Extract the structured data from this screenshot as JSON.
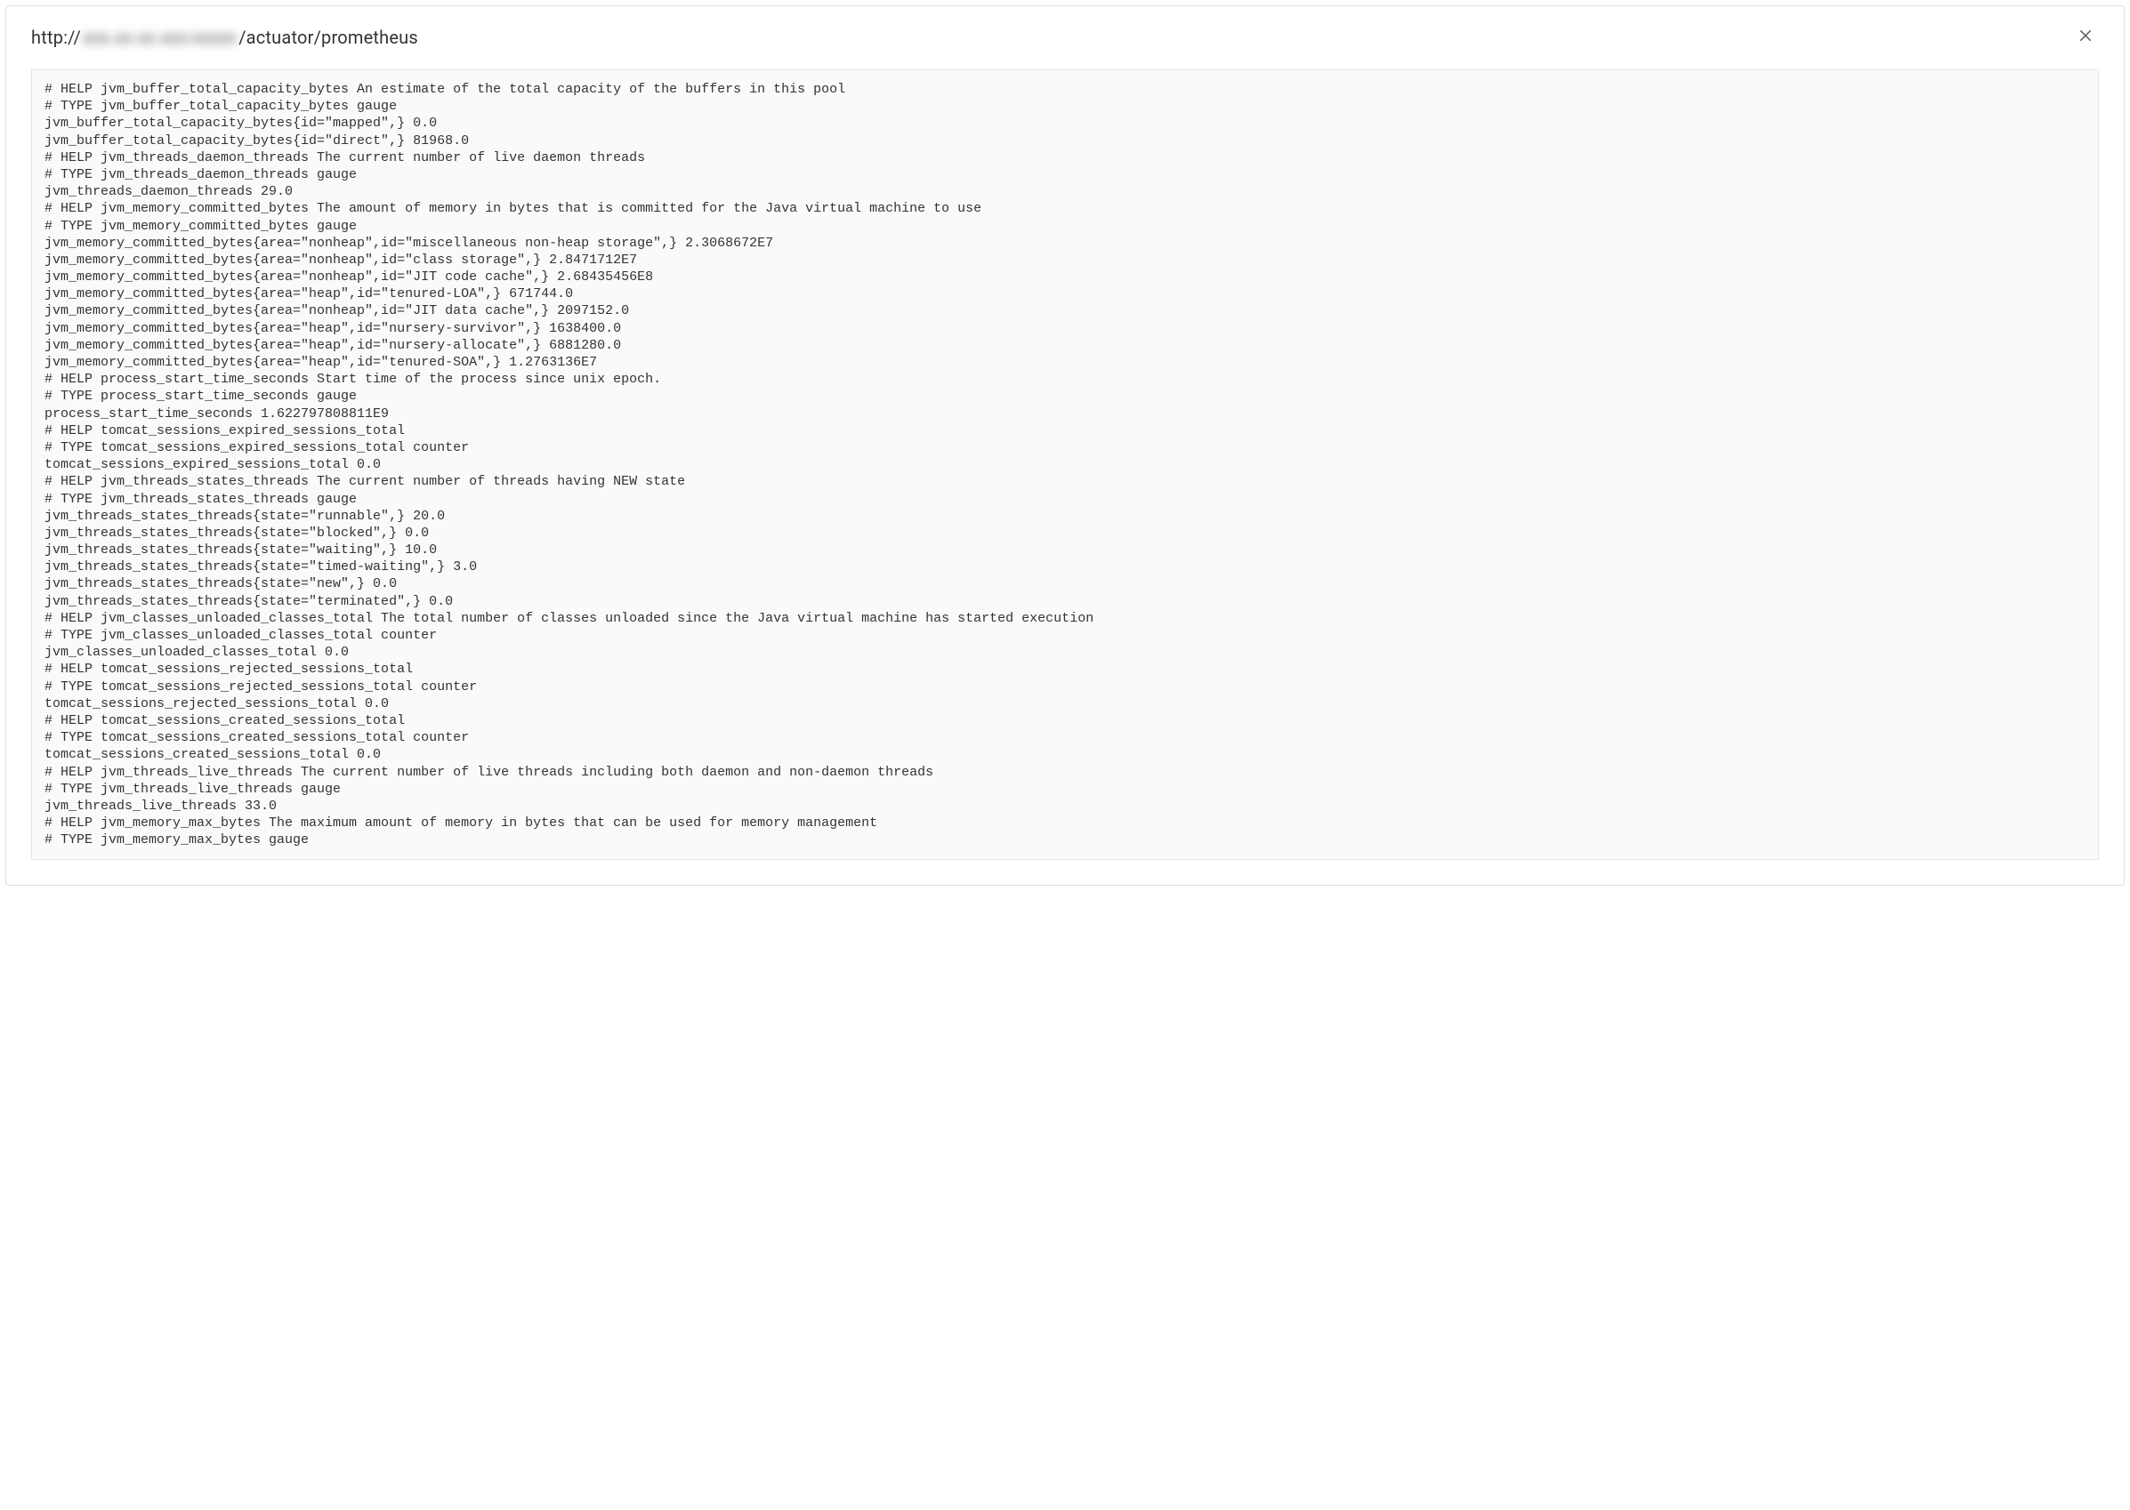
{
  "header": {
    "url_prefix": "http://",
    "url_obscured": "xxx.xx.xx.xxx:xxxxx",
    "url_path": "/actuator/prometheus"
  },
  "metrics_lines": [
    "# HELP jvm_buffer_total_capacity_bytes An estimate of the total capacity of the buffers in this pool",
    "# TYPE jvm_buffer_total_capacity_bytes gauge",
    "jvm_buffer_total_capacity_bytes{id=\"mapped\",} 0.0",
    "jvm_buffer_total_capacity_bytes{id=\"direct\",} 81968.0",
    "# HELP jvm_threads_daemon_threads The current number of live daemon threads",
    "# TYPE jvm_threads_daemon_threads gauge",
    "jvm_threads_daemon_threads 29.0",
    "# HELP jvm_memory_committed_bytes The amount of memory in bytes that is committed for the Java virtual machine to use",
    "# TYPE jvm_memory_committed_bytes gauge",
    "jvm_memory_committed_bytes{area=\"nonheap\",id=\"miscellaneous non-heap storage\",} 2.3068672E7",
    "jvm_memory_committed_bytes{area=\"nonheap\",id=\"class storage\",} 2.8471712E7",
    "jvm_memory_committed_bytes{area=\"nonheap\",id=\"JIT code cache\",} 2.68435456E8",
    "jvm_memory_committed_bytes{area=\"heap\",id=\"tenured-LOA\",} 671744.0",
    "jvm_memory_committed_bytes{area=\"nonheap\",id=\"JIT data cache\",} 2097152.0",
    "jvm_memory_committed_bytes{area=\"heap\",id=\"nursery-survivor\",} 1638400.0",
    "jvm_memory_committed_bytes{area=\"heap\",id=\"nursery-allocate\",} 6881280.0",
    "jvm_memory_committed_bytes{area=\"heap\",id=\"tenured-SOA\",} 1.2763136E7",
    "# HELP process_start_time_seconds Start time of the process since unix epoch.",
    "# TYPE process_start_time_seconds gauge",
    "process_start_time_seconds 1.622797808811E9",
    "# HELP tomcat_sessions_expired_sessions_total ",
    "# TYPE tomcat_sessions_expired_sessions_total counter",
    "tomcat_sessions_expired_sessions_total 0.0",
    "# HELP jvm_threads_states_threads The current number of threads having NEW state",
    "# TYPE jvm_threads_states_threads gauge",
    "jvm_threads_states_threads{state=\"runnable\",} 20.0",
    "jvm_threads_states_threads{state=\"blocked\",} 0.0",
    "jvm_threads_states_threads{state=\"waiting\",} 10.0",
    "jvm_threads_states_threads{state=\"timed-waiting\",} 3.0",
    "jvm_threads_states_threads{state=\"new\",} 0.0",
    "jvm_threads_states_threads{state=\"terminated\",} 0.0",
    "# HELP jvm_classes_unloaded_classes_total The total number of classes unloaded since the Java virtual machine has started execution",
    "# TYPE jvm_classes_unloaded_classes_total counter",
    "jvm_classes_unloaded_classes_total 0.0",
    "# HELP tomcat_sessions_rejected_sessions_total ",
    "# TYPE tomcat_sessions_rejected_sessions_total counter",
    "tomcat_sessions_rejected_sessions_total 0.0",
    "# HELP tomcat_sessions_created_sessions_total ",
    "# TYPE tomcat_sessions_created_sessions_total counter",
    "tomcat_sessions_created_sessions_total 0.0",
    "# HELP jvm_threads_live_threads The current number of live threads including both daemon and non-daemon threads",
    "# TYPE jvm_threads_live_threads gauge",
    "jvm_threads_live_threads 33.0",
    "# HELP jvm_memory_max_bytes The maximum amount of memory in bytes that can be used for memory management",
    "# TYPE jvm_memory_max_bytes gauge"
  ]
}
